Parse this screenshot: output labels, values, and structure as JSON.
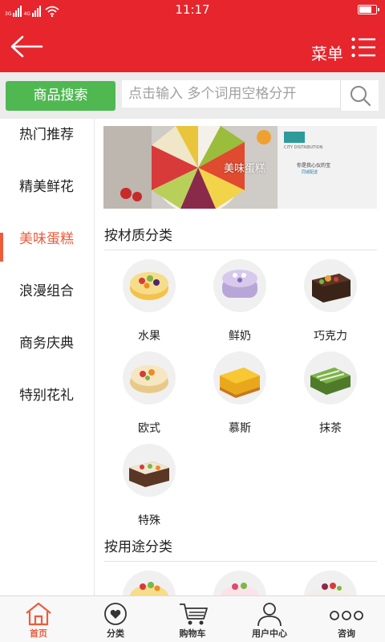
{
  "status_bar": {
    "network_1": "3G",
    "network_2": "4G",
    "time": "11:17",
    "battery_level": 0.8
  },
  "header": {
    "back_icon": "back-arrow-icon",
    "menu_label": "菜单",
    "menu_icon": "list-menu-icon"
  },
  "search": {
    "button_label": "商品搜索",
    "placeholder": "点击输入 多个词用空格分开",
    "icon": "search-icon"
  },
  "sidebar": {
    "items": [
      {
        "label": "热门推荐",
        "active": false
      },
      {
        "label": "精美鲜花",
        "active": false
      },
      {
        "label": "美味蛋糕",
        "active": true
      },
      {
        "label": "浪漫组合",
        "active": false
      },
      {
        "label": "商务庆典",
        "active": false
      },
      {
        "label": "特别花礼",
        "active": false
      }
    ]
  },
  "main": {
    "banner": {
      "title": "美味蛋糕",
      "side_text_1": "CITY DISTRIBUTION",
      "side_text_2": "你是我心仪的宝",
      "side_text_3": "同城配送"
    },
    "section_material": {
      "title": "按材质分类",
      "items": [
        {
          "label": "水果",
          "icon": "fruit-cake-icon"
        },
        {
          "label": "鲜奶",
          "icon": "cream-cake-icon"
        },
        {
          "label": "巧克力",
          "icon": "chocolate-cake-icon"
        },
        {
          "label": "欧式",
          "icon": "european-cake-icon"
        },
        {
          "label": "慕斯",
          "icon": "mousse-cake-icon"
        },
        {
          "label": "抹茶",
          "icon": "matcha-cake-icon"
        },
        {
          "label": "特殊",
          "icon": "special-cake-icon"
        }
      ]
    },
    "section_usage": {
      "title": "按用途分类"
    }
  },
  "tabbar": {
    "tabs": [
      {
        "label": "首页",
        "icon": "home-icon",
        "active": true
      },
      {
        "label": "分类",
        "icon": "category-icon",
        "active": false
      },
      {
        "label": "购物车",
        "icon": "cart-icon",
        "active": false
      },
      {
        "label": "用户中心",
        "icon": "user-icon",
        "active": false
      },
      {
        "label": "咨询",
        "icon": "more-dots-icon",
        "active": false
      }
    ]
  },
  "colors": {
    "brand_red": "#e6252d",
    "search_green": "#4fb851",
    "accent_orange": "#ec5c3c"
  }
}
